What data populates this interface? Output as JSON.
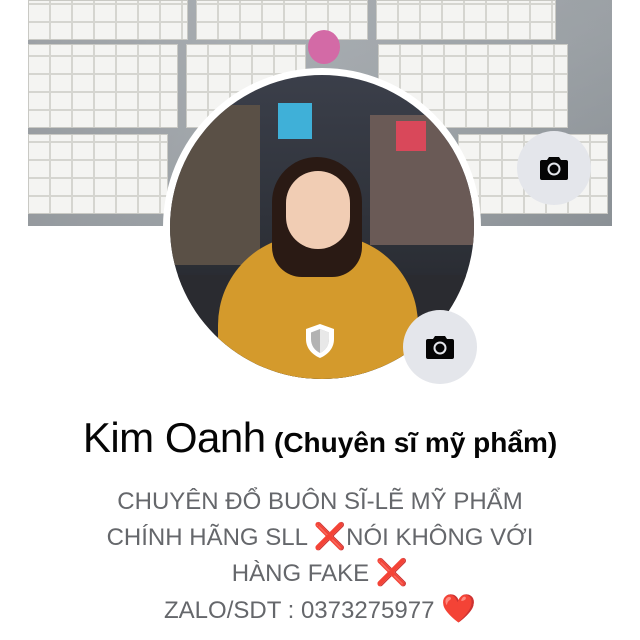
{
  "profile": {
    "name": "Kim Oanh",
    "alternate_name": "(Chuyên sĩ mỹ phẩm)"
  },
  "bio": {
    "line1": "CHUYÊN ĐỔ BUÔN SĨ-LẼ MỸ PHẨM",
    "line2a": "CHÍNH HÃNG SLL ",
    "line2_mark": "❌",
    "line2b": "NÓI KHÔNG VỚI",
    "line3a": "HÀNG FAKE ",
    "line3_mark": "❌",
    "line4a": "ZALO/SDT : 0373275977 ",
    "line4_mark": "❤️"
  },
  "icons": {
    "cover_camera": "camera-icon",
    "avatar_camera": "camera-icon",
    "profile_guard": "shield-icon"
  },
  "colors": {
    "name_text": "#050505",
    "bio_text": "#65676b",
    "button_bg": "#e4e6eb",
    "mark_red": "#dd2e44"
  }
}
